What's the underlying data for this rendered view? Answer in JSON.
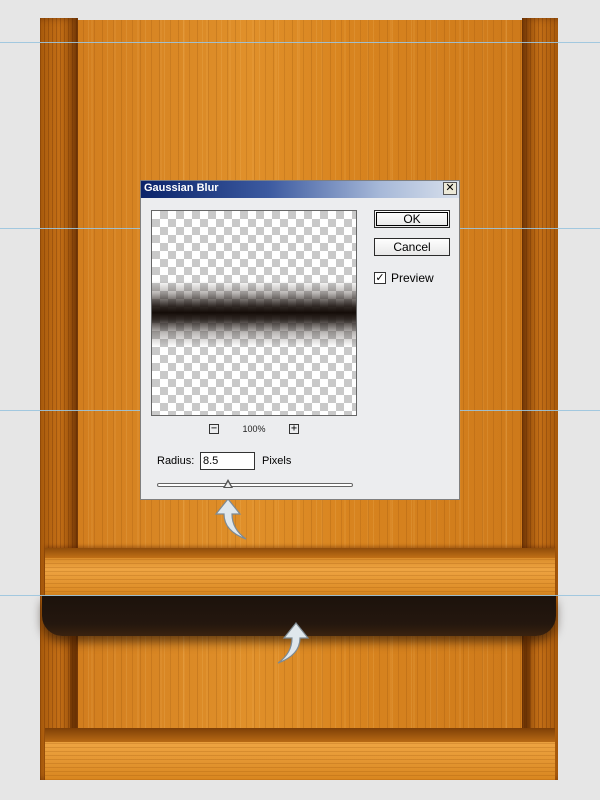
{
  "dialog": {
    "title": "Gaussian Blur",
    "close_glyph": "✕",
    "ok_label": "OK",
    "cancel_label": "Cancel",
    "preview_checked": true,
    "preview_label": "Preview",
    "check_glyph": "✓",
    "zoom": {
      "minus_glyph": "−",
      "plus_glyph": "+",
      "percent": "100%"
    },
    "radius": {
      "label": "Radius:",
      "value": "8.5",
      "units": "Pixels",
      "slider_fraction": 0.36
    }
  },
  "icons": {
    "arrow": "curved-up-arrow-icon"
  },
  "colors": {
    "wood": "#d6811f",
    "shadow": "#1c120c",
    "guide": "#9ac4de",
    "titlebar": "#0b246a"
  }
}
